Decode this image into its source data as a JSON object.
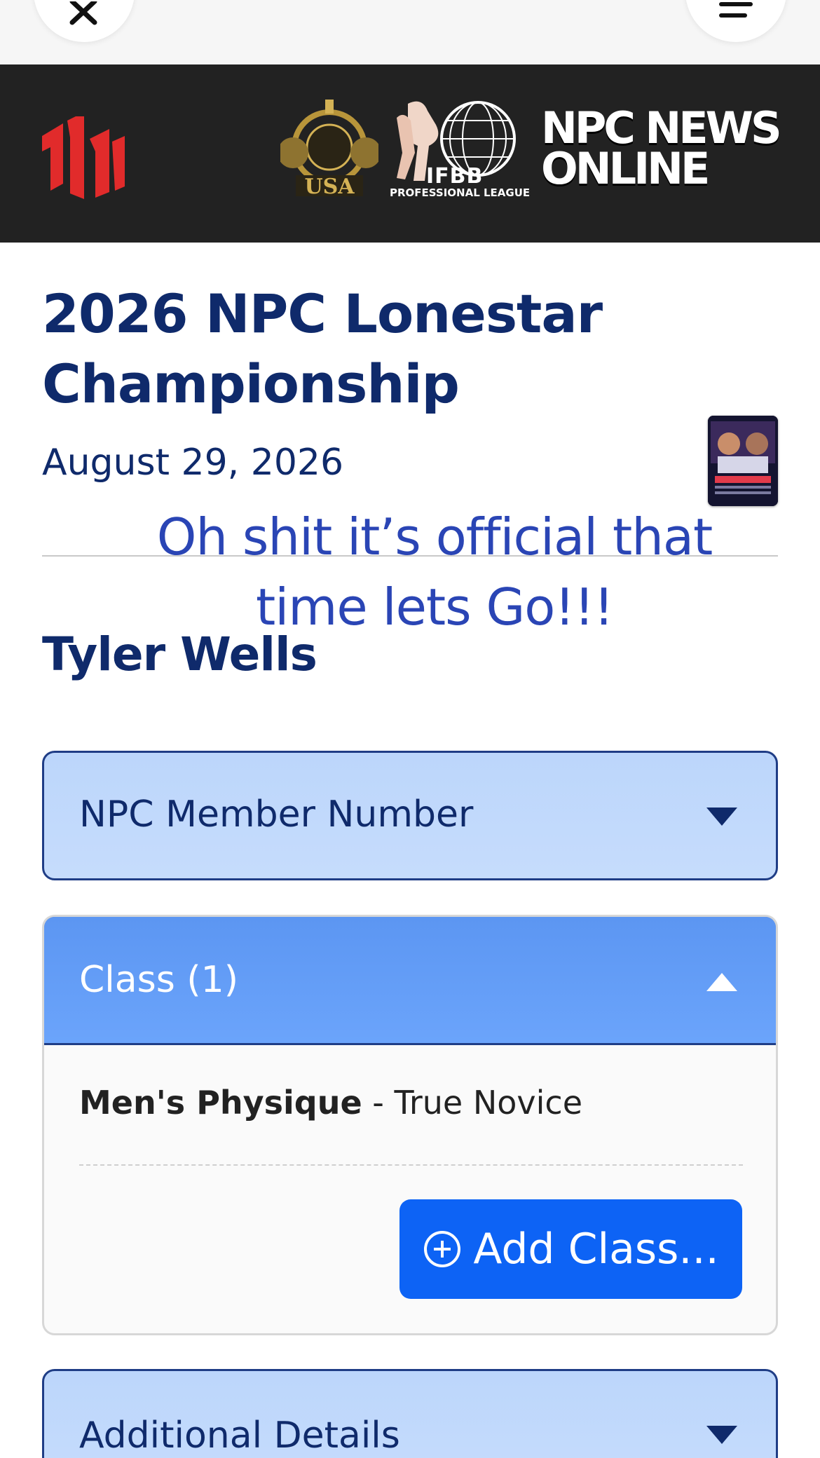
{
  "top_bar": {
    "close_icon": "close-icon",
    "menu_icon": "hamburger-menu-icon"
  },
  "banner": {
    "background": "#222222",
    "brand_color": "#e12b2b",
    "npc_seal_text": "USA",
    "ifbb_text": "IFBB",
    "ifbb_subtext": "PROFESSIONAL LEAGUE",
    "npc_news_line1": "NPC NEWS",
    "npc_news_line2": "ONLINE"
  },
  "event": {
    "title": "2026 NPC Lonestar Championship",
    "date": "August 29, 2026"
  },
  "overlay_caption": "Oh shit it’s official that time lets Go!!!",
  "athlete": {
    "name": "Tyler Wells"
  },
  "sections": {
    "member": {
      "label": "NPC Member Number",
      "expanded": false
    },
    "class": {
      "label": "Class (1)",
      "expanded": true,
      "items": [
        {
          "division": "Men's Physique",
          "separator": " - ",
          "level": "True Novice"
        }
      ],
      "add_button": "Add Class..."
    },
    "details": {
      "label": "Additional Details",
      "expanded": false
    }
  },
  "colors": {
    "heading": "#0f2a6b",
    "caption": "#2a45b5",
    "accordion_active": "#6ba4fb",
    "accordion_inactive": "#c6dcfc",
    "button": "#0d63f5"
  }
}
